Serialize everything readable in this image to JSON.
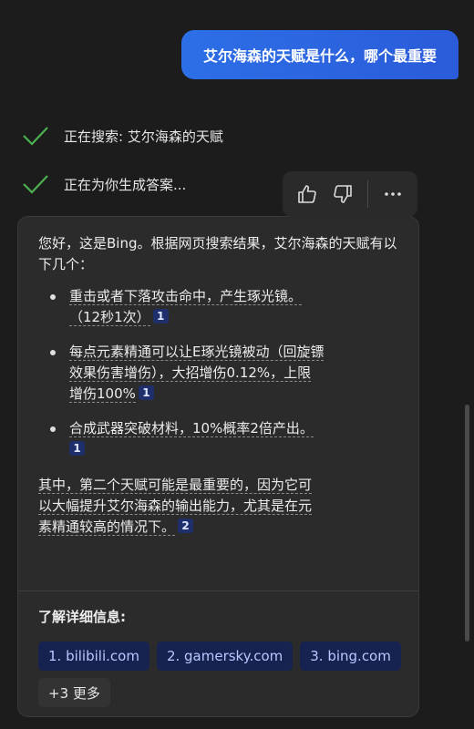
{
  "user_message": "艾尔海森的天赋是什么，哪个最重要",
  "status": [
    {
      "label": "正在搜索: 艾尔海森的天赋"
    },
    {
      "label": "正在为你生成答案..."
    }
  ],
  "answer": {
    "intro": "您好，这是Bing。根据网页搜索结果，艾尔海森的天赋有以下几个：",
    "bullets": [
      {
        "line1": "重击或者下落攻击命中，产生琢光镜。",
        "line2": "（12秒1次）",
        "cite": "1"
      },
      {
        "line1": "每点元素精通可以让E琢光镜被动（回旋镖",
        "line2": "效果伤害增伤），大招增伤0.12%，上限",
        "line3": "增伤100%",
        "cite": "1"
      },
      {
        "line1": "合成武器突破材料，10%概率2倍产出。",
        "cite": "1"
      }
    ],
    "conclusion": {
      "line1": "其中，第二个天赋可能是最重要的，因为它可",
      "line2": "以大幅提升艾尔海森的输出能力，尤其是在元",
      "line3": "素精通较高的情况下。",
      "cite": "2"
    }
  },
  "learn_more": {
    "title": "了解详细信息:",
    "links": [
      {
        "label": "1. bilibili.com"
      },
      {
        "label": "2. gamersky.com"
      },
      {
        "label": "3. bing.com"
      }
    ],
    "more": "+3 更多"
  }
}
